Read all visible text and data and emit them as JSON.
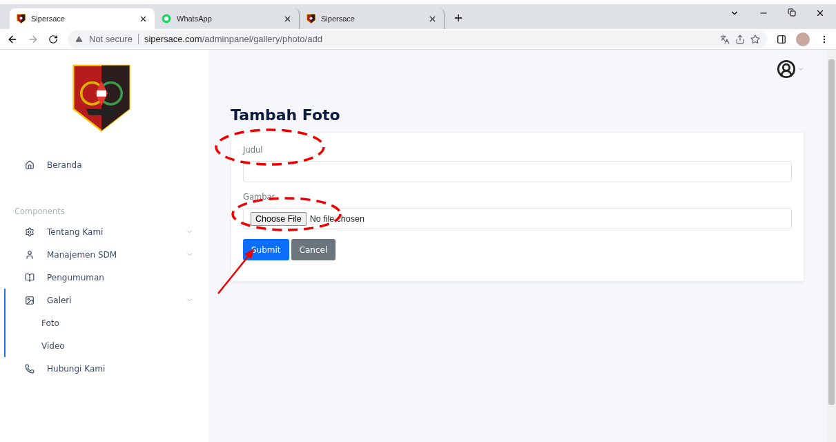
{
  "browser": {
    "tabs": [
      {
        "title": "Sipersace",
        "selected": true
      },
      {
        "title": "WhatsApp",
        "selected": false
      },
      {
        "title": "Sipersace",
        "selected": false
      }
    ],
    "security": "Not secure",
    "url_host": "sipersace.com",
    "url_path": "/adminpanel/gallery/photo/add"
  },
  "sidebar": {
    "items": [
      {
        "label": "Beranda",
        "kind": "link",
        "selected": false
      },
      {
        "section": "Components",
        "kind": "heading"
      },
      {
        "label": "Tentang Kami",
        "kind": "group",
        "selected": false
      },
      {
        "label": "Manajemen SDM",
        "kind": "group",
        "selected": false
      },
      {
        "label": "Pengumuman",
        "kind": "link",
        "selected": false
      },
      {
        "label": "Galeri",
        "kind": "group",
        "selected": true,
        "children": [
          {
            "label": "Foto"
          },
          {
            "label": "Video"
          }
        ]
      },
      {
        "label": "Hubungi Kami",
        "kind": "link",
        "selected": false
      }
    ]
  },
  "page": {
    "title": "Tambah Foto",
    "fields": [
      {
        "label": "Judul",
        "kind": "text"
      },
      {
        "label": "Gambar",
        "kind": "file",
        "button": "Choose File",
        "status": "No file chosen"
      }
    ],
    "buttons": [
      {
        "label": "Submit",
        "kind": "primary"
      },
      {
        "label": "Cancel",
        "kind": "secondary"
      }
    ]
  }
}
